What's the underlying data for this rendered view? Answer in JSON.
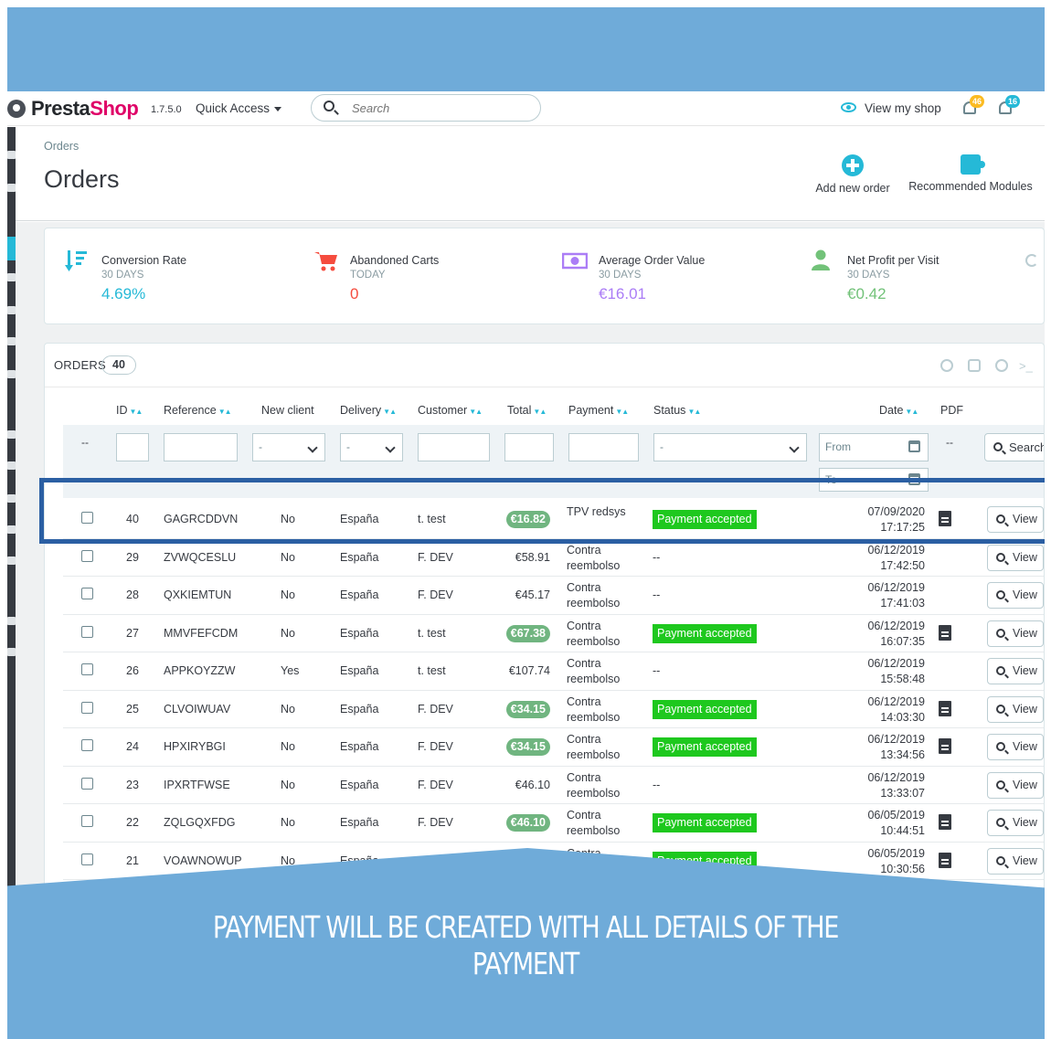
{
  "header": {
    "brand_part1": "Presta",
    "brand_part2": "Shop",
    "version": "1.7.5.0",
    "quick_access": "Quick Access",
    "search_placeholder": "Search",
    "view_shop": "View my shop",
    "notif_orders_count": "46",
    "notif_customers_count": "16"
  },
  "page": {
    "breadcrumb": "Orders",
    "title": "Orders",
    "toolbar": {
      "add_new_order": "Add new order",
      "recommended_modules": "Recommended Modules"
    }
  },
  "kpis": [
    {
      "title": "Conversion Rate",
      "period": "30 DAYS",
      "value": "4.69%",
      "color": "#25b9d7"
    },
    {
      "title": "Abandoned Carts",
      "period": "TODAY",
      "value": "0",
      "color": "#f54c3e"
    },
    {
      "title": "Average Order Value",
      "period": "30 DAYS",
      "value": "€16.01",
      "color": "#ab7df6"
    },
    {
      "title": "Net Profit per Visit",
      "period": "30 DAYS",
      "value": "€0.42",
      "color": "#72c279"
    }
  ],
  "orders": {
    "panel_title": "ORDERS",
    "count": "40",
    "columns": {
      "id": "ID",
      "reference": "Reference",
      "new_client": "New client",
      "delivery": "Delivery",
      "customer": "Customer",
      "total": "Total",
      "payment": "Payment",
      "status": "Status",
      "date": "Date",
      "pdf": "PDF"
    },
    "filters": {
      "bulk_dash": "--",
      "new_client_value": "-",
      "delivery_value": "-",
      "status_value": "-",
      "date_from_placeholder": "From",
      "date_to_placeholder": "To",
      "pdf_dash": "--",
      "search_button": "Search"
    },
    "view_label": "View",
    "rows": [
      {
        "id": "40",
        "reference": "GAGRCDDVN",
        "new_client": "No",
        "delivery": "España",
        "customer": "t. test",
        "total": "€16.82",
        "total_badge": true,
        "payment_line1": "TPV redsys",
        "payment_line2": "",
        "status": "Payment accepted",
        "date": "07/09/2020",
        "time": "17:17:25",
        "pdf": true
      },
      {
        "id": "29",
        "reference": "ZVWQCESLU",
        "new_client": "No",
        "delivery": "España",
        "customer": "F. DEV",
        "total": "€58.91",
        "total_badge": false,
        "payment_line1": "Contra",
        "payment_line2": "reembolso",
        "status": "--",
        "date": "06/12/2019",
        "time": "17:42:50",
        "pdf": false
      },
      {
        "id": "28",
        "reference": "QXKIEMTUN",
        "new_client": "No",
        "delivery": "España",
        "customer": "F. DEV",
        "total": "€45.17",
        "total_badge": false,
        "payment_line1": "Contra",
        "payment_line2": "reembolso",
        "status": "--",
        "date": "06/12/2019",
        "time": "17:41:03",
        "pdf": false
      },
      {
        "id": "27",
        "reference": "MMVFEFCDM",
        "new_client": "No",
        "delivery": "España",
        "customer": "t. test",
        "total": "€67.38",
        "total_badge": true,
        "payment_line1": "Contra",
        "payment_line2": "reembolso",
        "status": "Payment accepted",
        "date": "06/12/2019",
        "time": "16:07:35",
        "pdf": true
      },
      {
        "id": "26",
        "reference": "APPKOYZZW",
        "new_client": "Yes",
        "delivery": "España",
        "customer": "t. test",
        "total": "€107.74",
        "total_badge": false,
        "payment_line1": "Contra",
        "payment_line2": "reembolso",
        "status": "--",
        "date": "06/12/2019",
        "time": "15:58:48",
        "pdf": false
      },
      {
        "id": "25",
        "reference": "CLVOIWUAV",
        "new_client": "No",
        "delivery": "España",
        "customer": "F. DEV",
        "total": "€34.15",
        "total_badge": true,
        "payment_line1": "Contra",
        "payment_line2": "reembolso",
        "status": "Payment accepted",
        "date": "06/12/2019",
        "time": "14:03:30",
        "pdf": true
      },
      {
        "id": "24",
        "reference": "HPXIRYBGI",
        "new_client": "No",
        "delivery": "España",
        "customer": "F. DEV",
        "total": "€34.15",
        "total_badge": true,
        "payment_line1": "Contra",
        "payment_line2": "reembolso",
        "status": "Payment accepted",
        "date": "06/12/2019",
        "time": "13:34:56",
        "pdf": true
      },
      {
        "id": "23",
        "reference": "IPXRTFWSE",
        "new_client": "No",
        "delivery": "España",
        "customer": "F. DEV",
        "total": "€46.10",
        "total_badge": false,
        "payment_line1": "Contra",
        "payment_line2": "reembolso",
        "status": "--",
        "date": "06/12/2019",
        "time": "13:33:07",
        "pdf": false
      },
      {
        "id": "22",
        "reference": "ZQLGQXFDG",
        "new_client": "No",
        "delivery": "España",
        "customer": "F. DEV",
        "total": "€46.10",
        "total_badge": true,
        "payment_line1": "Contra",
        "payment_line2": "reembolso",
        "status": "Payment accepted",
        "date": "06/05/2019",
        "time": "10:44:51",
        "pdf": true
      },
      {
        "id": "21",
        "reference": "VOAWNOWUP",
        "new_client": "No",
        "delivery": "España",
        "customer": "F. DEV",
        "total": "",
        "total_badge": true,
        "payment_line1": "Contra",
        "payment_line2": "",
        "status": "Payment accepted",
        "date": "06/05/2019",
        "time": "10:30:56",
        "pdf": true
      }
    ]
  },
  "caption": {
    "line1": "PAYMENT WILL BE CREATED WITH ALL DETAILS OF THE",
    "line2": "PAYMENT"
  },
  "colors": {
    "band": "#6fabd9",
    "highlight_border": "#2b5fa3",
    "accent": "#25b9d7",
    "status_accepted": "#1ec81e",
    "total_badge": "#70b580"
  }
}
